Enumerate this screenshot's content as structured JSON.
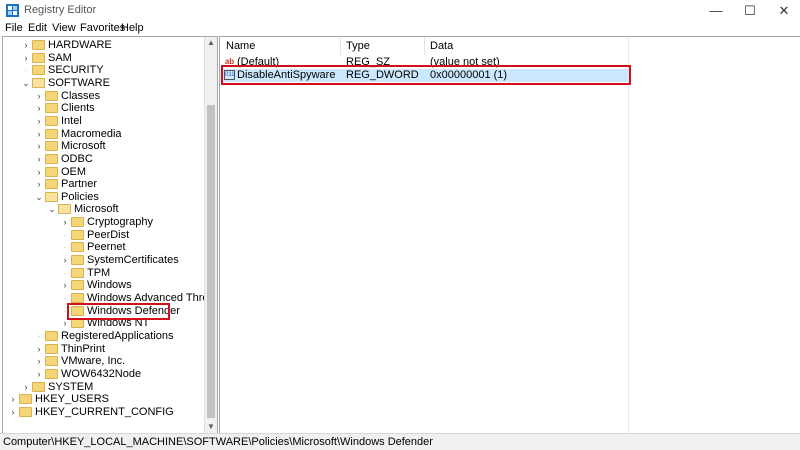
{
  "window": {
    "title": "Registry Editor",
    "minimize_glyph": "—",
    "maximize_glyph": "☐",
    "close_glyph": "✕"
  },
  "menu": [
    "File",
    "Edit",
    "View",
    "Favorites",
    "Help"
  ],
  "tree": [
    {
      "label": "HARDWARE",
      "depth": 2,
      "expander": "collapsed",
      "open": false
    },
    {
      "label": "SAM",
      "depth": 2,
      "expander": "collapsed",
      "open": false
    },
    {
      "label": "SECURITY",
      "depth": 2,
      "expander": "none",
      "open": false
    },
    {
      "label": "SOFTWARE",
      "depth": 2,
      "expander": "expanded",
      "open": true
    },
    {
      "label": "Classes",
      "depth": 3,
      "expander": "collapsed",
      "open": false
    },
    {
      "label": "Clients",
      "depth": 3,
      "expander": "collapsed",
      "open": false
    },
    {
      "label": "Intel",
      "depth": 3,
      "expander": "collapsed",
      "open": false
    },
    {
      "label": "Macromedia",
      "depth": 3,
      "expander": "collapsed",
      "open": false
    },
    {
      "label": "Microsoft",
      "depth": 3,
      "expander": "collapsed",
      "open": false
    },
    {
      "label": "ODBC",
      "depth": 3,
      "expander": "collapsed",
      "open": false
    },
    {
      "label": "OEM",
      "depth": 3,
      "expander": "collapsed",
      "open": false
    },
    {
      "label": "Partner",
      "depth": 3,
      "expander": "collapsed",
      "open": false
    },
    {
      "label": "Policies",
      "depth": 3,
      "expander": "expanded",
      "open": true
    },
    {
      "label": "Microsoft",
      "depth": 4,
      "expander": "expanded",
      "open": true
    },
    {
      "label": "Cryptography",
      "depth": 5,
      "expander": "collapsed",
      "open": false
    },
    {
      "label": "PeerDist",
      "depth": 5,
      "expander": "none",
      "open": false
    },
    {
      "label": "Peernet",
      "depth": 5,
      "expander": "none",
      "open": false
    },
    {
      "label": "SystemCertificates",
      "depth": 5,
      "expander": "collapsed",
      "open": false
    },
    {
      "label": "TPM",
      "depth": 5,
      "expander": "none",
      "open": false
    },
    {
      "label": "Windows",
      "depth": 5,
      "expander": "collapsed",
      "open": false
    },
    {
      "label": "Windows Advanced Threat P",
      "depth": 5,
      "expander": "none",
      "open": false
    },
    {
      "label": "Windows Defender",
      "depth": 5,
      "expander": "none",
      "open": false,
      "highlighted": true
    },
    {
      "label": "Windows NT",
      "depth": 5,
      "expander": "collapsed",
      "open": false
    },
    {
      "label": "RegisteredApplications",
      "depth": 3,
      "expander": "none",
      "open": false
    },
    {
      "label": "ThinPrint",
      "depth": 3,
      "expander": "collapsed",
      "open": false
    },
    {
      "label": "VMware, Inc.",
      "depth": 3,
      "expander": "collapsed",
      "open": false
    },
    {
      "label": "WOW6432Node",
      "depth": 3,
      "expander": "collapsed",
      "open": false
    },
    {
      "label": "SYSTEM",
      "depth": 2,
      "expander": "collapsed",
      "open": false
    },
    {
      "label": "HKEY_USERS",
      "depth": 1,
      "expander": "collapsed",
      "open": false
    },
    {
      "label": "HKEY_CURRENT_CONFIG",
      "depth": 1,
      "expander": "collapsed",
      "open": false
    }
  ],
  "scrollbar": {
    "up_glyph": "▲",
    "down_glyph": "▼"
  },
  "columns": {
    "name": "Name",
    "type": "Type",
    "data": "Data"
  },
  "values": [
    {
      "icon": "string-value-icon",
      "icon_glyph": "ab",
      "name": "(Default)",
      "type": "REG_SZ",
      "data": "(value not set)",
      "selected": false
    },
    {
      "icon": "binary-value-icon",
      "icon_glyph": "011",
      "name": "DisableAntiSpyware",
      "type": "REG_DWORD",
      "data": "0x00000001 (1)",
      "selected": true
    }
  ],
  "status": "Computer\\HKEY_LOCAL_MACHINE\\SOFTWARE\\Policies\\Microsoft\\Windows Defender",
  "colors": {
    "highlight_border": "#d0101a",
    "selected_row": "#cce8ff",
    "folder": "#f4d577"
  }
}
